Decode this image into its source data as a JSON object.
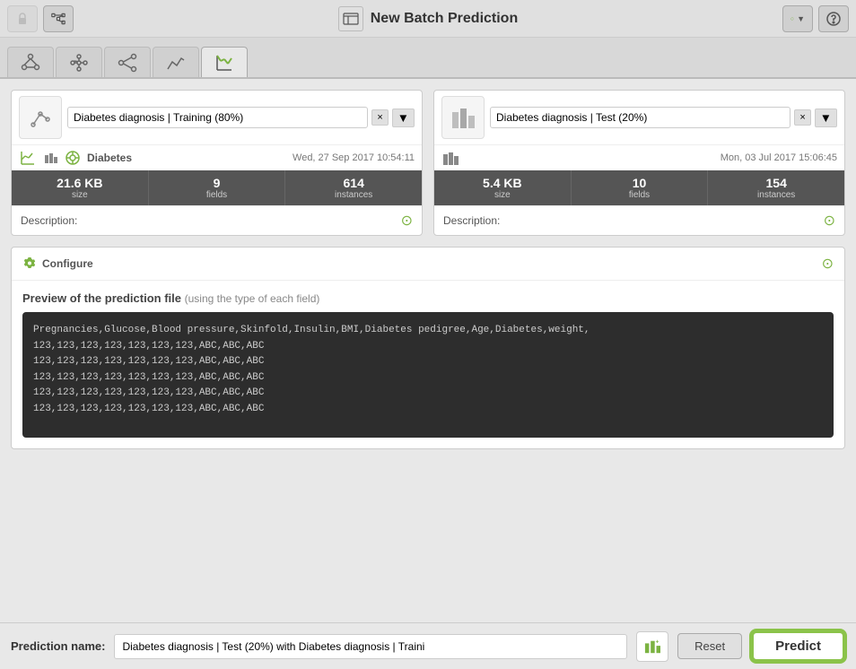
{
  "topbar": {
    "title": "New Batch Prediction",
    "refresh_label": "⟳",
    "help_label": "?"
  },
  "tabs": [
    {
      "id": "tab1",
      "icon": "nodes",
      "active": false
    },
    {
      "id": "tab2",
      "icon": "network",
      "active": false
    },
    {
      "id": "tab3",
      "icon": "share",
      "active": false
    },
    {
      "id": "tab4",
      "icon": "line",
      "active": false
    },
    {
      "id": "tab5",
      "icon": "scatter",
      "active": true
    }
  ],
  "left_panel": {
    "dataset_value": "Diabetes diagnosis | Training (80%)",
    "model_name": "Diabetes",
    "date": "Wed, 27 Sep 2017 10:54:11",
    "stats": [
      {
        "value": "21.6 KB",
        "label": "size"
      },
      {
        "value": "9",
        "label": "fields"
      },
      {
        "value": "614",
        "label": "instances"
      }
    ],
    "description_label": "Description:"
  },
  "right_panel": {
    "dataset_value": "Diabetes diagnosis | Test (20%)",
    "date": "Mon, 03 Jul 2017 15:06:45",
    "stats": [
      {
        "value": "5.4 KB",
        "label": "size"
      },
      {
        "value": "10",
        "label": "fields"
      },
      {
        "value": "154",
        "label": "instances"
      }
    ],
    "description_label": "Description:"
  },
  "configure": {
    "title": "Configure"
  },
  "preview": {
    "title": "Preview of the prediction file",
    "subtitle": "(using the type of each field)",
    "code_lines": [
      "Pregnancies,Glucose,Blood pressure,Skinfold,Insulin,BMI,Diabetes pedigree,Age,Diabetes,weight,",
      "123,123,123,123,123,123,123,ABC,ABC,ABC",
      "123,123,123,123,123,123,123,ABC,ABC,ABC",
      "123,123,123,123,123,123,123,ABC,ABC,ABC",
      "123,123,123,123,123,123,123,ABC,ABC,ABC",
      "123,123,123,123,123,123,123,ABC,ABC,ABC"
    ]
  },
  "bottom": {
    "prediction_label": "Prediction name:",
    "prediction_value": "Diabetes diagnosis | Test (20%) with Diabetes diagnosis | Traini",
    "reset_label": "Reset",
    "predict_label": "Predict"
  }
}
